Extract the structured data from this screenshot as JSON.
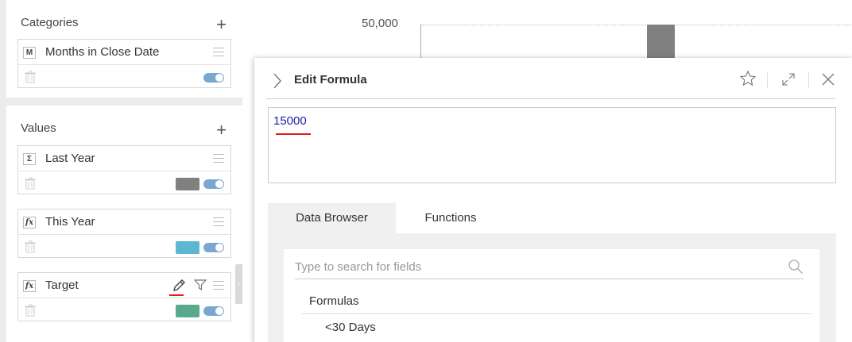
{
  "categories": {
    "title": "Categories",
    "items": [
      {
        "badge": "M",
        "label": "Months in Close Date"
      }
    ]
  },
  "values": {
    "title": "Values",
    "items": [
      {
        "badge": "Σ",
        "label": "Last Year",
        "color": "#808080"
      },
      {
        "badge": "fx",
        "label": "This Year",
        "color": "#5bb8d0"
      },
      {
        "badge": "fx",
        "label": "Target",
        "color": "#5aa88e"
      }
    ]
  },
  "chart": {
    "y_tick": "50,000",
    "bar_color": "#808080"
  },
  "formula_panel": {
    "title": "Edit Formula",
    "formula_value": "15000",
    "tabs": [
      {
        "label": "Data Browser",
        "active": true
      },
      {
        "label": "Functions",
        "active": false
      }
    ],
    "search_placeholder": "Type to search for fields",
    "group_label": "Formulas",
    "items": [
      "<30 Days"
    ]
  },
  "colors": {
    "accent_red": "#e01b1b",
    "toggle": "#7aa7d0",
    "formula_text": "#1d1da8"
  }
}
